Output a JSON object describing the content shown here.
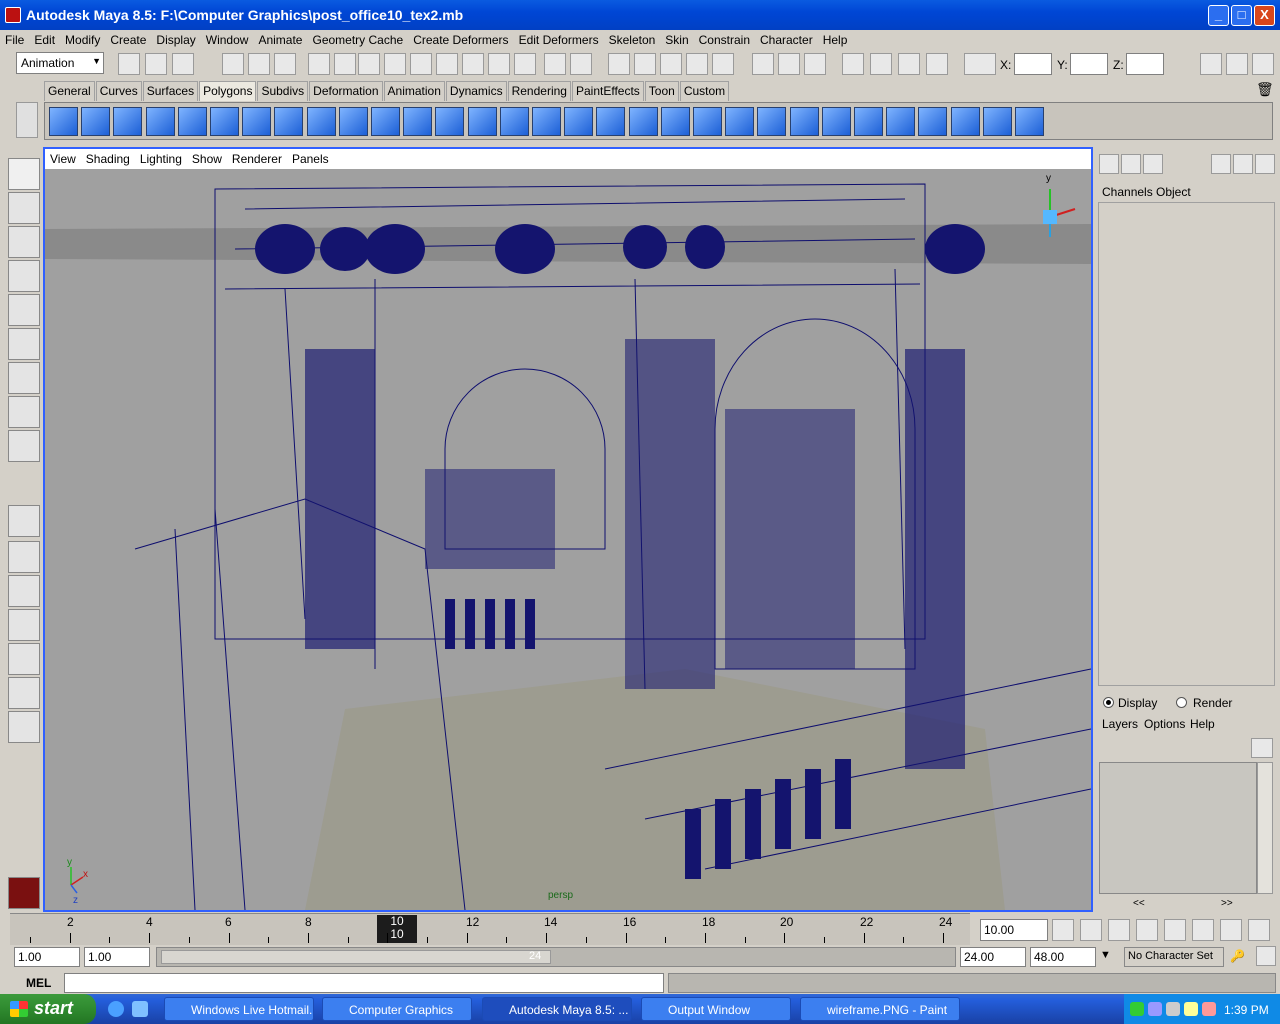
{
  "window": {
    "title": "Autodesk Maya 8.5: F:\\Computer Graphics\\post_office10_tex2.mb",
    "minimize": "_",
    "maximize": "□",
    "close": "X"
  },
  "menubar": [
    "File",
    "Edit",
    "Modify",
    "Create",
    "Display",
    "Window",
    "Animate",
    "Geometry Cache",
    "Create Deformers",
    "Edit Deformers",
    "Skeleton",
    "Skin",
    "Constrain",
    "Character",
    "Help"
  ],
  "statusline": {
    "mode": "Animation",
    "x_label": "X:",
    "y_label": "Y:",
    "z_label": "Z:"
  },
  "shelf": {
    "tabs": [
      "General",
      "Curves",
      "Surfaces",
      "Polygons",
      "Subdivs",
      "Deformation",
      "Animation",
      "Dynamics",
      "Rendering",
      "PaintEffects",
      "Toon",
      "Custom"
    ],
    "active_tab": "Polygons"
  },
  "viewport": {
    "menu": [
      "View",
      "Shading",
      "Lighting",
      "Show",
      "Renderer",
      "Panels"
    ],
    "camera_label": "persp",
    "axis_y": "y",
    "axis_x": "x",
    "axis_z": "z",
    "colors": {
      "wire": "#0e0e6e",
      "background": "#a0a0a0",
      "floor": "#9d9c90",
      "active_border": "#3060ff"
    }
  },
  "channelbox": {
    "tabs": [
      "Channels",
      "Object"
    ],
    "display_label": "Display",
    "render_label": "Render",
    "layer_menu": [
      "Layers",
      "Options",
      "Help"
    ],
    "scroll_left": "<<",
    "scroll_right": ">>"
  },
  "timeline": {
    "ticks": [
      "2",
      "4",
      "6",
      "8",
      "10",
      "12",
      "14",
      "16",
      "18",
      "20",
      "22",
      "24"
    ],
    "current_frame": "10",
    "current_frame_top": "10",
    "current_time": "10.00"
  },
  "range": {
    "start": "1.00",
    "playback_start": "1.00",
    "slider_end": "24",
    "playback_end": "24.00",
    "end": "48.00",
    "character_set": "No Character Set"
  },
  "cmdline": {
    "label": "MEL"
  },
  "taskbar": {
    "start": "start",
    "tasks": [
      "Windows Live Hotmail...",
      "Computer Graphics",
      "Autodesk Maya 8.5: ...",
      "Output Window",
      "wireframe.PNG - Paint"
    ],
    "active_task": 2,
    "clock": "1:39 PM"
  }
}
